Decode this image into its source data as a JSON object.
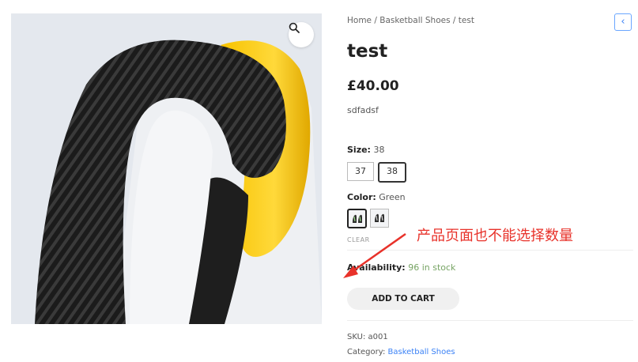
{
  "breadcrumb": {
    "home": "Home",
    "sep1": " / ",
    "category": "Basketball Shoes",
    "sep2": " / ",
    "current": "test"
  },
  "product": {
    "title": "test",
    "price": "£40.00",
    "description": "sdfadsf"
  },
  "size": {
    "label": "Size:",
    "selected": "38",
    "options": [
      "37",
      "38"
    ]
  },
  "color": {
    "label": "Color:",
    "selected": "Green",
    "clear_label": "CLEAR"
  },
  "availability": {
    "label": "Availability:",
    "value": "96 in stock"
  },
  "cart": {
    "button_label": "ADD TO CART"
  },
  "meta": {
    "sku_label": "SKU:",
    "sku_value": "a001",
    "category_label": "Category:",
    "category_value": "Basketball Shoes"
  },
  "annotation": {
    "text": "产品页面也不能选择数量",
    "color": "#e8322a"
  },
  "icons": {
    "zoom": "magnifier-icon",
    "back": "chevron-left-icon"
  },
  "colors": {
    "accent": "#3b82f6",
    "stock": "#77a464",
    "button_bg": "#f0f0f0"
  }
}
